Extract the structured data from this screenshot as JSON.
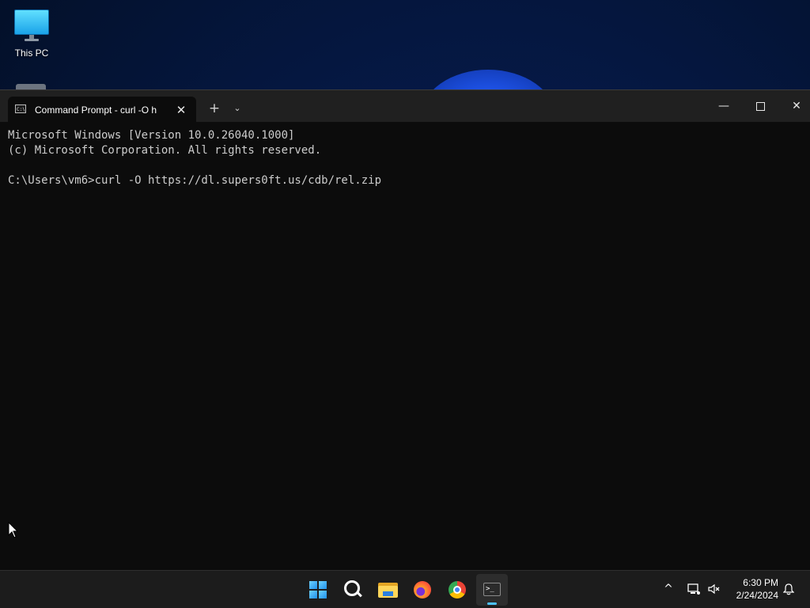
{
  "desktop": {
    "icons": [
      {
        "label": "This PC"
      }
    ]
  },
  "window": {
    "tab_title": "Command Prompt - curl  -O h",
    "tab_icon_text": "C:\\",
    "new_tab_symbol": "+",
    "dropdown_symbol": "⌄",
    "close_tab_symbol": "✕",
    "minimize_symbol": "—",
    "close_symbol": "✕"
  },
  "console": {
    "lines": [
      "Microsoft Windows [Version 10.0.26040.1000]",
      "(c) Microsoft Corporation. All rights reserved.",
      "",
      "C:\\Users\\vm6>curl -O https://dl.supers0ft.us/cdb/rel.zip"
    ]
  },
  "taskbar": {
    "terminal_icon_text": ">_",
    "tray_chevron": "^",
    "clock": {
      "time": "6:30 PM",
      "date": "2/24/2024"
    }
  },
  "colors": {
    "console_bg": "#0c0c0c",
    "console_text": "#cccccc",
    "titlebar_bg": "#202020",
    "taskbar_bg": "#1c1c1c",
    "accent": "#4cc2ff"
  }
}
